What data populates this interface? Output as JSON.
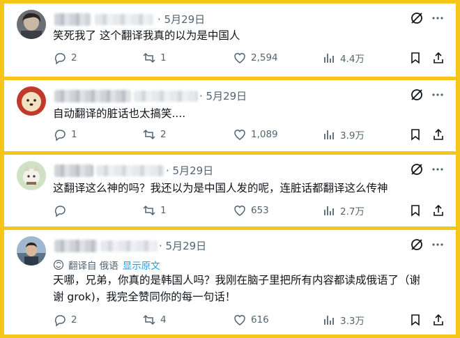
{
  "posts": [
    {
      "date": "· 5月29日",
      "text_lines": [
        "笑死我了 这个翻译我真的以为是中国人"
      ],
      "translated": false,
      "replies": "2",
      "reposts": "1",
      "likes": "2,594",
      "views": "4.4万"
    },
    {
      "date": "· 5月29日",
      "text_lines": [
        "自动翻译的脏话也太搞笑...."
      ],
      "translated": false,
      "replies": "1",
      "reposts": "2",
      "likes": "1,089",
      "views": "3.9万"
    },
    {
      "date": "· 5月29日",
      "text_lines": [
        "这翻译这么神的吗？我还以为是中国人发的呢，连脏话都翻译这么传神"
      ],
      "translated": false,
      "replies": "",
      "reposts": "1",
      "likes": "653",
      "views": "2.7万"
    },
    {
      "date": "· 5月29日",
      "translate_label": "翻译自 俄语",
      "show_original": "显示原文",
      "text_lines": [
        "天哪，兄弟，你真的是韩国人吗？我刚在脑子里把所有内容都读成俄语了（谢",
        "谢 grok)，我完全赞同你的每一句话！"
      ],
      "translated": true,
      "replies": "2",
      "reposts": "4",
      "likes": "616",
      "views": "3.3万"
    }
  ],
  "colors": {
    "border": "#f5c518",
    "text": "#0f1419",
    "muted": "#536471",
    "link": "#1d9bf0"
  },
  "icons": [
    "reply-icon",
    "repost-icon",
    "like-icon",
    "views-icon",
    "bookmark-icon",
    "share-icon",
    "grok-icon",
    "more-icon",
    "translate-icon"
  ]
}
